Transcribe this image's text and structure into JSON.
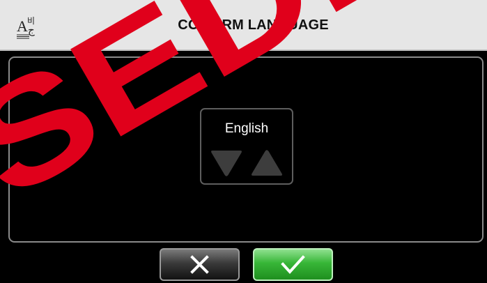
{
  "header": {
    "icon": "language-icon",
    "title": "CONFIRM LANGUAGE"
  },
  "selector": {
    "current_language": "English",
    "down_icon": "triangle-down-icon",
    "up_icon": "triangle-up-icon"
  },
  "buttons": {
    "cancel_icon": "close-icon",
    "confirm_icon": "checkmark-icon"
  },
  "watermark": {
    "text": "SEDE",
    "color": "#e0001b"
  },
  "colors": {
    "header_bg": "#e6e6e6",
    "confirm_green": "#37b637",
    "cancel_gray": "#3a3a3a"
  }
}
